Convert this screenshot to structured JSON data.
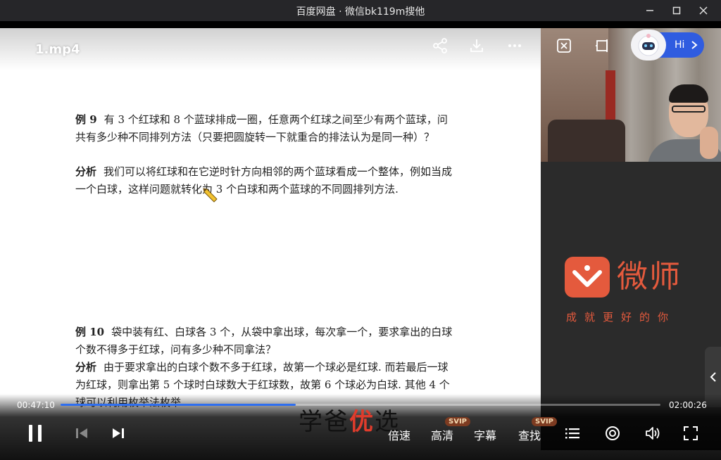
{
  "window": {
    "title": "百度网盘 · 微信bk119m搜他"
  },
  "video": {
    "file_name": "1.mp4"
  },
  "document": {
    "ex9_label": "例 9",
    "ex9_text": "有 3 个红球和 8 个蓝球排成一圈，任意两个红球之间至少有两个蓝球，问共有多少种不同排列方法（只要把圆旋转一下就重合的排法认为是同一种）？",
    "analysis9_label": "分析",
    "analysis9_text": "我们可以将红球和在它逆时针方向相邻的两个蓝球看成一个整体，例如当成一个白球，这样问题就转化为 3 个白球和两个蓝球的不同圆排列方法.",
    "ex10_label": "例 10",
    "ex10_text": "袋中装有红、白球各 3 个，从袋中拿出球，每次拿一个，要求拿出的白球个数不得多于红球，问有多少种不同拿法？",
    "analysis10_label": "分析",
    "analysis10_text": "由于要求拿出的白球个数不多于红球，故第一个球必是红球. 而若最后一球为红球，则拿出第 5 个球时白球数大于红球数，故第 6 个球必为白球. 其他 4 个球可以利用枚举法枚举."
  },
  "panel": {
    "brand_name": "微师",
    "slogan": "成就更好的你"
  },
  "assistant": {
    "label": "Hi"
  },
  "playback": {
    "current_time": "00:47:10",
    "total_time": "02:00:26",
    "progress": 0.3918
  },
  "controls": {
    "speed": "倍速",
    "quality": "高清",
    "subtitles": "字幕",
    "search": "查找",
    "svip_badge": "SVIP"
  },
  "watermark": {
    "part1": "学爸",
    "part2": "优",
    "part3": "选"
  },
  "colors": {
    "accent": "#2f6ff0",
    "brand": "#e45a3d"
  }
}
